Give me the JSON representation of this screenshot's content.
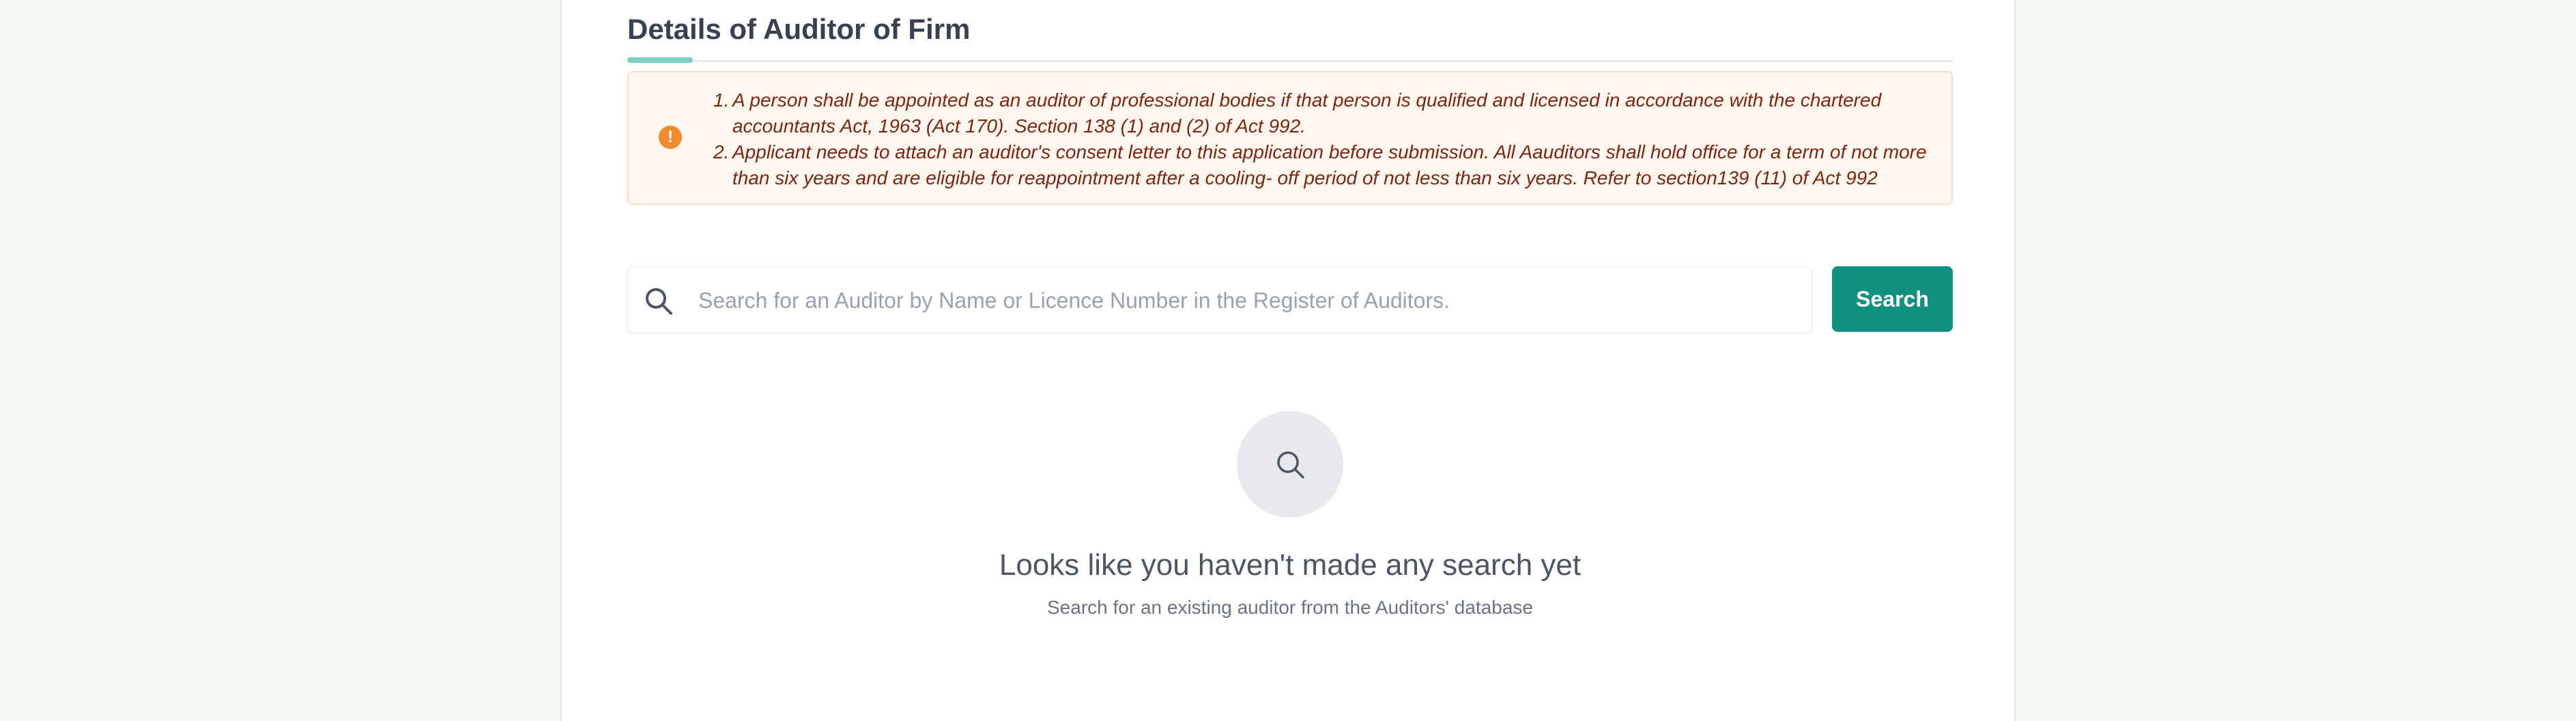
{
  "section": {
    "title": "Details of Auditor of Firm"
  },
  "notice": {
    "icon": "exclamation-circle-icon",
    "items": [
      {
        "number": "1.",
        "text": "A person shall be appointed as an auditor of professional bodies if that person is qualified and licensed in accordance with the chartered accountants Act, 1963 (Act 170). Section 138 (1) and (2) of Act 992."
      },
      {
        "number": "2.",
        "text": "Applicant needs to attach an auditor's consent letter to this application before submission. All Aauditors shall hold office for a term of not more than six years and are eligible for reappointment after a cooling- off period of not less than six years. Refer to section139 (11) of Act 992"
      }
    ]
  },
  "search": {
    "icon": "search-icon",
    "value": "",
    "placeholder": "Search for an Auditor by Name or Licence Number in the Register of Auditors.",
    "button_label": "Search"
  },
  "empty_state": {
    "icon": "search-icon",
    "title": "Looks like you haven't made any search yet",
    "subtitle": "Search for an existing auditor from the Auditors' database"
  },
  "colors": {
    "accent": "#0e9180",
    "accent_light": "#7ccdc1",
    "notice_background": "#fff6ee",
    "notice_text": "#7a2612",
    "notice_icon": "#f08a2c",
    "page_background": "#f4f9f4"
  }
}
